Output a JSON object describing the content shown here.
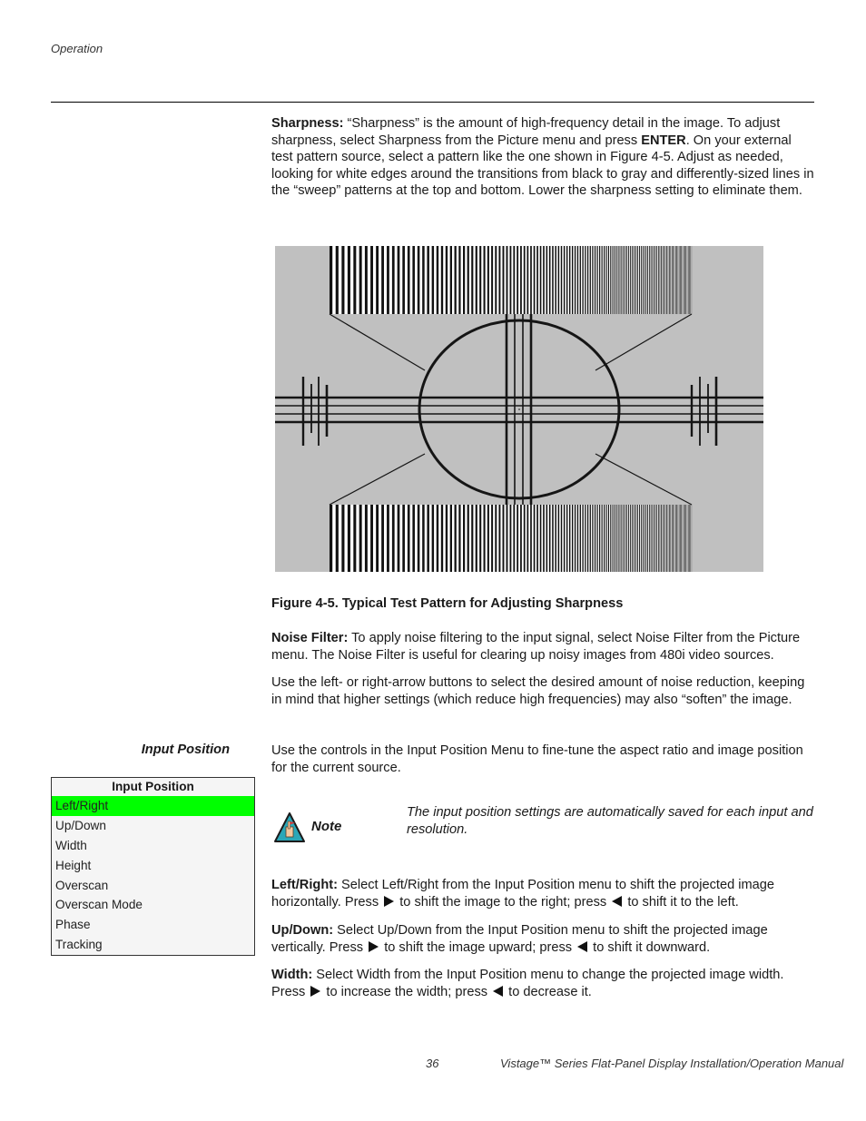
{
  "header": {
    "section": "Operation"
  },
  "sharpness": {
    "term": "Sharpness:",
    "text_1": " “Sharpness” is the amount of high-frequency detail in the image. To adjust sharpness, select Sharpness from the Picture menu and press ",
    "key": "ENTER",
    "text_2": ". On your external test pattern source, select a pattern like the one shown in Figure 4-5. Adjust as needed, looking for white edges around the transitions from black to gray and differently-sized lines in the “sweep” patterns at the top and bottom. Lower the sharpness setting to eliminate them."
  },
  "figure": {
    "caption": "Figure 4-5. Typical Test Pattern for Adjusting Sharpness",
    "background": "#c0c0c0",
    "line_color": "#151515"
  },
  "noise_filter": {
    "term": "Noise Filter:",
    "text": " To apply noise filtering to the input signal, select Noise Filter from the Picture menu. The Noise Filter is useful for clearing up noisy images from 480i video sources.",
    "para2": "Use the left- or right-arrow buttons to select the desired amount of noise reduction, keeping in mind that higher settings (which reduce high frequencies) may also “soften” the image."
  },
  "input_position": {
    "heading": "Input Position",
    "intro": "Use the controls in the Input Position Menu to fine-tune the aspect ratio and image position for the current source.",
    "menu": {
      "title": "Input Position",
      "selected_color": "#00ff00",
      "items": [
        {
          "label": "Left/Right",
          "selected": true
        },
        {
          "label": "Up/Down",
          "selected": false
        },
        {
          "label": "Width",
          "selected": false
        },
        {
          "label": "Height",
          "selected": false
        },
        {
          "label": "Overscan",
          "selected": false
        },
        {
          "label": "Overscan Mode",
          "selected": false
        },
        {
          "label": "Phase",
          "selected": false
        },
        {
          "label": "Tracking",
          "selected": false
        }
      ]
    },
    "note": {
      "icon": "note-hand-icon",
      "label": "Note",
      "text": "The input position settings are automatically saved for each input and resolution."
    },
    "left_right": {
      "term": "Left/Right:",
      "text_1": " Select Left/Right from the Input Position menu to shift the projected image horizontally. Press ",
      "text_2": " to shift the image to the right; press ",
      "text_3": " to shift it to the left."
    },
    "up_down": {
      "term": "Up/Down:",
      "text_1": " Select Up/Down from the Input Position menu to shift the projected image vertically. Press ",
      "text_2": " to shift the image upward; press ",
      "text_3": " to shift it downward."
    },
    "width": {
      "term": "Width:",
      "text_1": " Select Width from the Input Position menu to change the projected image width. Press ",
      "text_2": " to increase the width; press ",
      "text_3": " to decrease it."
    }
  },
  "footer": {
    "page_number": "36",
    "manual_title": "Vistage™ Series Flat-Panel Display Installation/Operation Manual"
  }
}
